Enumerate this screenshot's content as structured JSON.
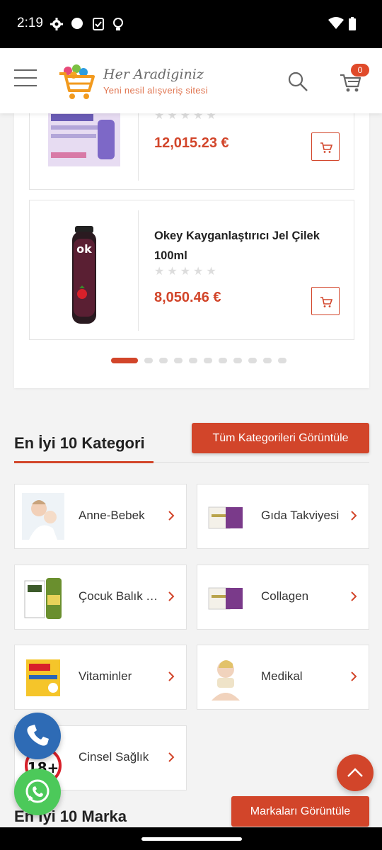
{
  "status_bar": {
    "time": "2:19"
  },
  "header": {
    "logo_name": "Her Aradiginiz",
    "logo_tagline": "Yeni nesil alışveriş sitesi",
    "cart_count": "0"
  },
  "products": [
    {
      "name": "",
      "price": "12,015.23 €",
      "rating": 0
    },
    {
      "name": "Okey Kayganlaştırıcı Jel Çilek 100ml",
      "price": "8,050.46 €",
      "rating": 0
    }
  ],
  "carousel": {
    "dot_count": 11,
    "active_index": 0
  },
  "categories_section": {
    "title": "En İyi 10 Kategori",
    "view_all_label": "Tüm Kategorileri Görüntüle",
    "items": [
      {
        "label": "Anne-Bebek"
      },
      {
        "label": "Gıda Takviyesi"
      },
      {
        "label": "Çocuk Balık Yağı"
      },
      {
        "label": "Collagen"
      },
      {
        "label": "Vitaminler"
      },
      {
        "label": "Medikal"
      },
      {
        "label": "Cinsel Sağlık"
      }
    ]
  },
  "brands_section": {
    "title": "En İyi 10 Marka",
    "view_all_label": "Markaları Görüntüle"
  },
  "colors": {
    "accent": "#d2452a",
    "whatsapp": "#4cc95a",
    "phone": "#2e6bb5"
  }
}
